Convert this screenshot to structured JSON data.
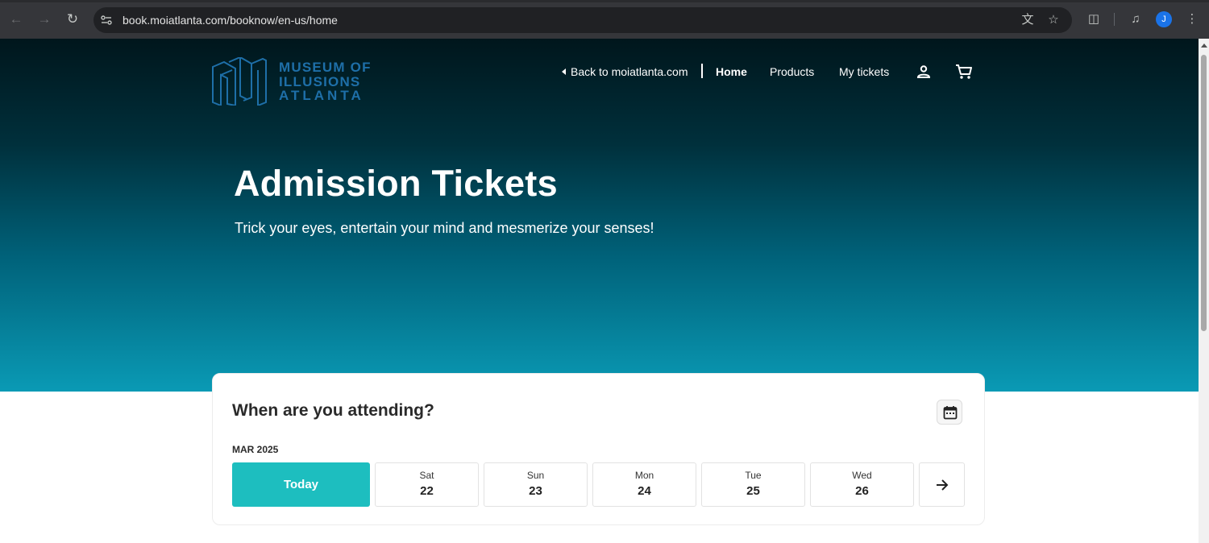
{
  "browser": {
    "url": "book.moiatlanta.com/booknow/en-us/home",
    "profile_initial": "J",
    "icons": [
      "back-arrow-icon",
      "forward-arrow-icon",
      "reload-icon",
      "site-info-icon",
      "translate-icon",
      "bookmark-star-icon",
      "extensions-icon",
      "media-controls-icon",
      "more-menu-icon"
    ]
  },
  "header": {
    "logo_lines": [
      "MUSEUM OF",
      "ILLUSIONS",
      "ATLANTA"
    ],
    "back_link": "Back to moiatlanta.com",
    "nav": {
      "home": "Home",
      "products": "Products",
      "my_tickets": "My tickets"
    },
    "icons": [
      "account-icon",
      "cart-icon"
    ]
  },
  "hero": {
    "title": "Admission Tickets",
    "subtitle": "Trick your eyes, entertain your mind and mesmerize your senses!"
  },
  "date_picker": {
    "title": "When are you attending?",
    "month": "MAR 2025",
    "today_label": "Today",
    "days": [
      {
        "dow": "Sat",
        "num": "22"
      },
      {
        "dow": "Sun",
        "num": "23"
      },
      {
        "dow": "Mon",
        "num": "24"
      },
      {
        "dow": "Tue",
        "num": "25"
      },
      {
        "dow": "Wed",
        "num": "26"
      }
    ]
  },
  "colors": {
    "accent": "#1dbebf",
    "logo": "#1e6fa8",
    "hero_top": "#00161c",
    "hero_bottom": "#0a9ab5"
  }
}
